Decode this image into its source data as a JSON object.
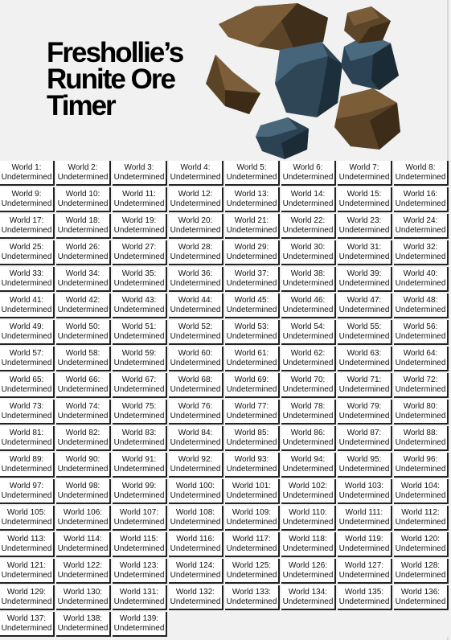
{
  "title_lines": [
    "Freshollie’s",
    "Runite Ore",
    "Timer"
  ],
  "colors": {
    "background": "#f1f1f1",
    "cell_background": "#ffffff",
    "cell_border": "#222222",
    "rock_brown": "#5a4226",
    "rock_blue": "#2d4454"
  },
  "icons": [
    "runite-ore-rocks-icon"
  ],
  "worlds": [
    {
      "label": "World 1:",
      "status": "Undetermined"
    },
    {
      "label": "World 2:",
      "status": "Undetermined"
    },
    {
      "label": "World 3:",
      "status": "Undetermined"
    },
    {
      "label": "World 4:",
      "status": "Undetermined"
    },
    {
      "label": "World 5:",
      "status": "Undetermined"
    },
    {
      "label": "World 6:",
      "status": "Undetermined"
    },
    {
      "label": "World 7:",
      "status": "Undetermined"
    },
    {
      "label": "World 8:",
      "status": "Undetermined"
    },
    {
      "label": "World 9:",
      "status": "Undetermined"
    },
    {
      "label": "World 10:",
      "status": "Undetermined"
    },
    {
      "label": "World 11:",
      "status": "Undetermined"
    },
    {
      "label": "World 12:",
      "status": "Undetermined"
    },
    {
      "label": "World 13:",
      "status": "Undetermined"
    },
    {
      "label": "World 14:",
      "status": "Undetermined"
    },
    {
      "label": "World 15:",
      "status": "Undetermined"
    },
    {
      "label": "World 16:",
      "status": "Undetermined"
    },
    {
      "label": "World 17:",
      "status": "Undetermined"
    },
    {
      "label": "World 18:",
      "status": "Undetermined"
    },
    {
      "label": "World 19:",
      "status": "Undetermined"
    },
    {
      "label": "World 20:",
      "status": "Undetermined"
    },
    {
      "label": "World 21:",
      "status": "Undetermined"
    },
    {
      "label": "World 22:",
      "status": "Undetermined"
    },
    {
      "label": "World 23:",
      "status": "Undetermined"
    },
    {
      "label": "World 24:",
      "status": "Undetermined"
    },
    {
      "label": "World 25:",
      "status": "Undetermined"
    },
    {
      "label": "World 26:",
      "status": "Undetermined"
    },
    {
      "label": "World 27:",
      "status": "Undetermined"
    },
    {
      "label": "World 28:",
      "status": "Undetermined"
    },
    {
      "label": "World 29:",
      "status": "Undetermined"
    },
    {
      "label": "World 30:",
      "status": "Undetermined"
    },
    {
      "label": "World 31:",
      "status": "Undetermined"
    },
    {
      "label": "World 32:",
      "status": "Undetermined"
    },
    {
      "label": "World 33:",
      "status": "Undetermined"
    },
    {
      "label": "World 34:",
      "status": "Undetermined"
    },
    {
      "label": "World 35:",
      "status": "Undetermined"
    },
    {
      "label": "World 36:",
      "status": "Undetermined"
    },
    {
      "label": "World 37:",
      "status": "Undetermined"
    },
    {
      "label": "World 38:",
      "status": "Undetermined"
    },
    {
      "label": "World 39:",
      "status": "Undetermined"
    },
    {
      "label": "World 40:",
      "status": "Undetermined"
    },
    {
      "label": "World 41:",
      "status": "Undetermined"
    },
    {
      "label": "World 42:",
      "status": "Undetermined"
    },
    {
      "label": "World 43:",
      "status": "Undetermined"
    },
    {
      "label": "World 44:",
      "status": "Undetermined"
    },
    {
      "label": "World 45:",
      "status": "Undetermined"
    },
    {
      "label": "World 46:",
      "status": "Undetermined"
    },
    {
      "label": "World 47:",
      "status": "Undetermined"
    },
    {
      "label": "World 48:",
      "status": "Undetermined"
    },
    {
      "label": "World 49:",
      "status": "Undetermined"
    },
    {
      "label": "World 50:",
      "status": "Undetermined"
    },
    {
      "label": "World 51:",
      "status": "Undetermined"
    },
    {
      "label": "World 52:",
      "status": "Undetermined"
    },
    {
      "label": "World 53:",
      "status": "Undetermined"
    },
    {
      "label": "World 54:",
      "status": "Undetermined"
    },
    {
      "label": "World 55:",
      "status": "Undetermined"
    },
    {
      "label": "World 56:",
      "status": "Undetermined"
    },
    {
      "label": "World 57:",
      "status": "Undetermined"
    },
    {
      "label": "World 58:",
      "status": "Undetermined"
    },
    {
      "label": "World 59:",
      "status": "Undetermined"
    },
    {
      "label": "World 60:",
      "status": "Undetermined"
    },
    {
      "label": "World 61:",
      "status": "Undetermined"
    },
    {
      "label": "World 62:",
      "status": "Undetermined"
    },
    {
      "label": "World 63:",
      "status": "Undetermined"
    },
    {
      "label": "World 64:",
      "status": "Undetermined"
    },
    {
      "label": "World 65:",
      "status": "Undetermined"
    },
    {
      "label": "World 66:",
      "status": "Undetermined"
    },
    {
      "label": "World 67:",
      "status": "Undetermined"
    },
    {
      "label": "World 68:",
      "status": "Undetermined"
    },
    {
      "label": "World 69:",
      "status": "Undetermined"
    },
    {
      "label": "World 70:",
      "status": "Undetermined"
    },
    {
      "label": "World 71:",
      "status": "Undetermined"
    },
    {
      "label": "World 72:",
      "status": "Undetermined"
    },
    {
      "label": "World 73:",
      "status": "Undetermined"
    },
    {
      "label": "World 74:",
      "status": "Undetermined"
    },
    {
      "label": "World 75:",
      "status": "Undetermined"
    },
    {
      "label": "World 76:",
      "status": "Undetermined"
    },
    {
      "label": "World 77:",
      "status": "Undetermined"
    },
    {
      "label": "World 78:",
      "status": "Undetermined"
    },
    {
      "label": "World 79:",
      "status": "Undetermined"
    },
    {
      "label": "World 80:",
      "status": "Undetermined"
    },
    {
      "label": "World 81:",
      "status": "Undetermined"
    },
    {
      "label": "World 82:",
      "status": "Undetermined"
    },
    {
      "label": "World 83:",
      "status": "Undetermined"
    },
    {
      "label": "World 84:",
      "status": "Undetermined"
    },
    {
      "label": "World 85:",
      "status": "Undetermined"
    },
    {
      "label": "World 86:",
      "status": "Undetermined"
    },
    {
      "label": "World 87:",
      "status": "Undetermined"
    },
    {
      "label": "World 88:",
      "status": "Undetermined"
    },
    {
      "label": "World 89:",
      "status": "Undetermined"
    },
    {
      "label": "World 90:",
      "status": "Undetermined"
    },
    {
      "label": "World 91:",
      "status": "Undetermined"
    },
    {
      "label": "World 92:",
      "status": "Undetermined"
    },
    {
      "label": "World 93:",
      "status": "Undetermined"
    },
    {
      "label": "World 94:",
      "status": "Undetermined"
    },
    {
      "label": "World 95:",
      "status": "Undetermined"
    },
    {
      "label": "World 96:",
      "status": "Undetermined"
    },
    {
      "label": "World 97:",
      "status": "Undetermined"
    },
    {
      "label": "World 98:",
      "status": "Undetermined"
    },
    {
      "label": "World 99:",
      "status": "Undetermined"
    },
    {
      "label": "World 100:",
      "status": "Undetermined"
    },
    {
      "label": "World 101:",
      "status": "Undetermined"
    },
    {
      "label": "World 102:",
      "status": "Undetermined"
    },
    {
      "label": "World 103:",
      "status": "Undetermined"
    },
    {
      "label": "World 104:",
      "status": "Undetermined"
    },
    {
      "label": "World 105:",
      "status": "Undetermined"
    },
    {
      "label": "World 106:",
      "status": "Undetermined"
    },
    {
      "label": "World 107:",
      "status": "Undetermined"
    },
    {
      "label": "World 108:",
      "status": "Undetermined"
    },
    {
      "label": "World 109:",
      "status": "Undetermined"
    },
    {
      "label": "World 110:",
      "status": "Undetermined"
    },
    {
      "label": "World 111:",
      "status": "Undetermined"
    },
    {
      "label": "World 112:",
      "status": "Undetermined"
    },
    {
      "label": "World 113:",
      "status": "Undetermined"
    },
    {
      "label": "World 114:",
      "status": "Undetermined"
    },
    {
      "label": "World 115:",
      "status": "Undetermined"
    },
    {
      "label": "World 116:",
      "status": "Undetermined"
    },
    {
      "label": "World 117:",
      "status": "Undetermined"
    },
    {
      "label": "World 118:",
      "status": "Undetermined"
    },
    {
      "label": "World 119:",
      "status": "Undetermined"
    },
    {
      "label": "World 120:",
      "status": "Undetermined"
    },
    {
      "label": "World 121:",
      "status": "Undetermined"
    },
    {
      "label": "World 122:",
      "status": "Undetermined"
    },
    {
      "label": "World 123:",
      "status": "Undetermined"
    },
    {
      "label": "World 124:",
      "status": "Undetermined"
    },
    {
      "label": "World 125:",
      "status": "Undetermined"
    },
    {
      "label": "World 126:",
      "status": "Undetermined"
    },
    {
      "label": "World 127:",
      "status": "Undetermined"
    },
    {
      "label": "World 128:",
      "status": "Undetermined"
    },
    {
      "label": "World 129:",
      "status": "Undetermined"
    },
    {
      "label": "World 130:",
      "status": "Undetermined"
    },
    {
      "label": "World 131:",
      "status": "Undetermined"
    },
    {
      "label": "World 132:",
      "status": "Undetermined"
    },
    {
      "label": "World 133:",
      "status": "Undetermined"
    },
    {
      "label": "World 134:",
      "status": "Undetermined"
    },
    {
      "label": "World 135:",
      "status": "Undetermined"
    },
    {
      "label": "World 136:",
      "status": "Undetermined"
    },
    {
      "label": "World 137:",
      "status": "Undetermined"
    },
    {
      "label": "World 138:",
      "status": "Undetermined"
    },
    {
      "label": "World 139:",
      "status": "Undetermined"
    }
  ]
}
